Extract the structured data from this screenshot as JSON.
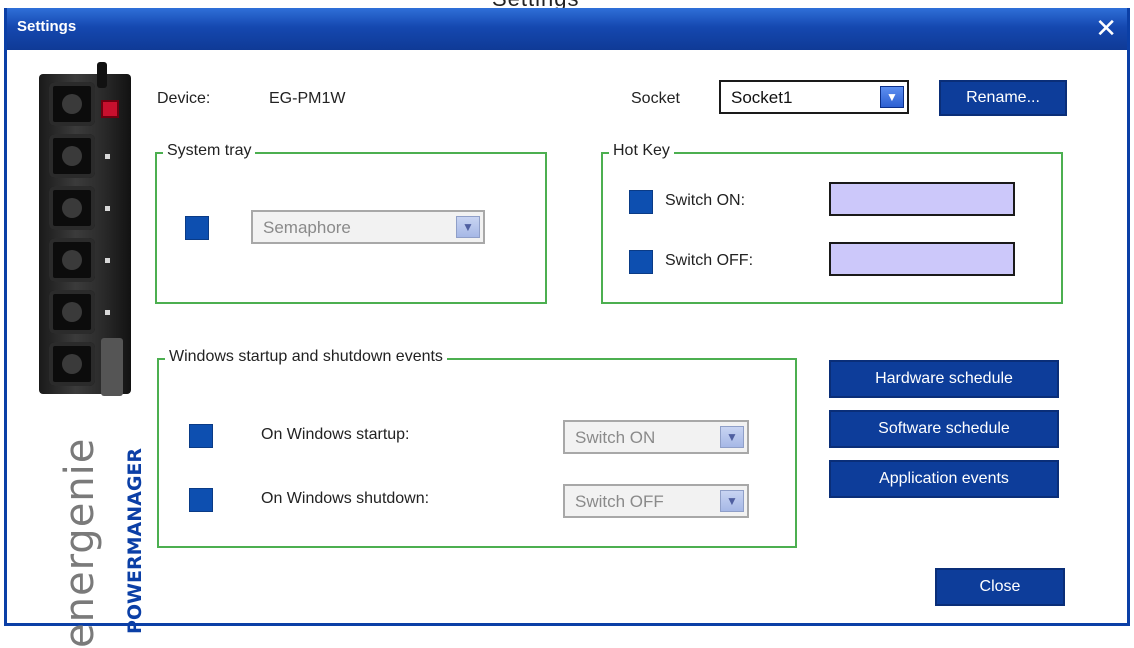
{
  "cropped_heading": "Settings",
  "window": {
    "title": "Settings",
    "close_glyph": "✕"
  },
  "brand": {
    "logo_text": "energenie",
    "product_text": "POWERMANAGER"
  },
  "device": {
    "label": "Device:",
    "value": "EG-PM1W"
  },
  "socket": {
    "label": "Socket",
    "selected": "Socket1",
    "rename_label": "Rename..."
  },
  "system_tray": {
    "legend": "System tray",
    "selected": "Semaphore"
  },
  "hot_key": {
    "legend": "Hot Key",
    "switch_on_label": "Switch ON:",
    "switch_off_label": "Switch OFF:"
  },
  "windows_events": {
    "legend": "Windows startup and shutdown events",
    "startup_label": "On Windows startup:",
    "startup_selected": "Switch ON",
    "shutdown_label": "On Windows shutdown:",
    "shutdown_selected": "Switch OFF"
  },
  "buttons": {
    "hardware_schedule": "Hardware schedule",
    "software_schedule": "Software schedule",
    "application_events": "Application events",
    "close": "Close"
  },
  "icons": {
    "dropdown_arrow": "chevron-down-icon",
    "close": "close-icon"
  },
  "colors": {
    "titlebar": "#1548b0",
    "button": "#0d3d9a",
    "group_border": "#4caf50",
    "checkbox": "#0d4fb0",
    "hotkey_field": "#ccc8fa"
  }
}
